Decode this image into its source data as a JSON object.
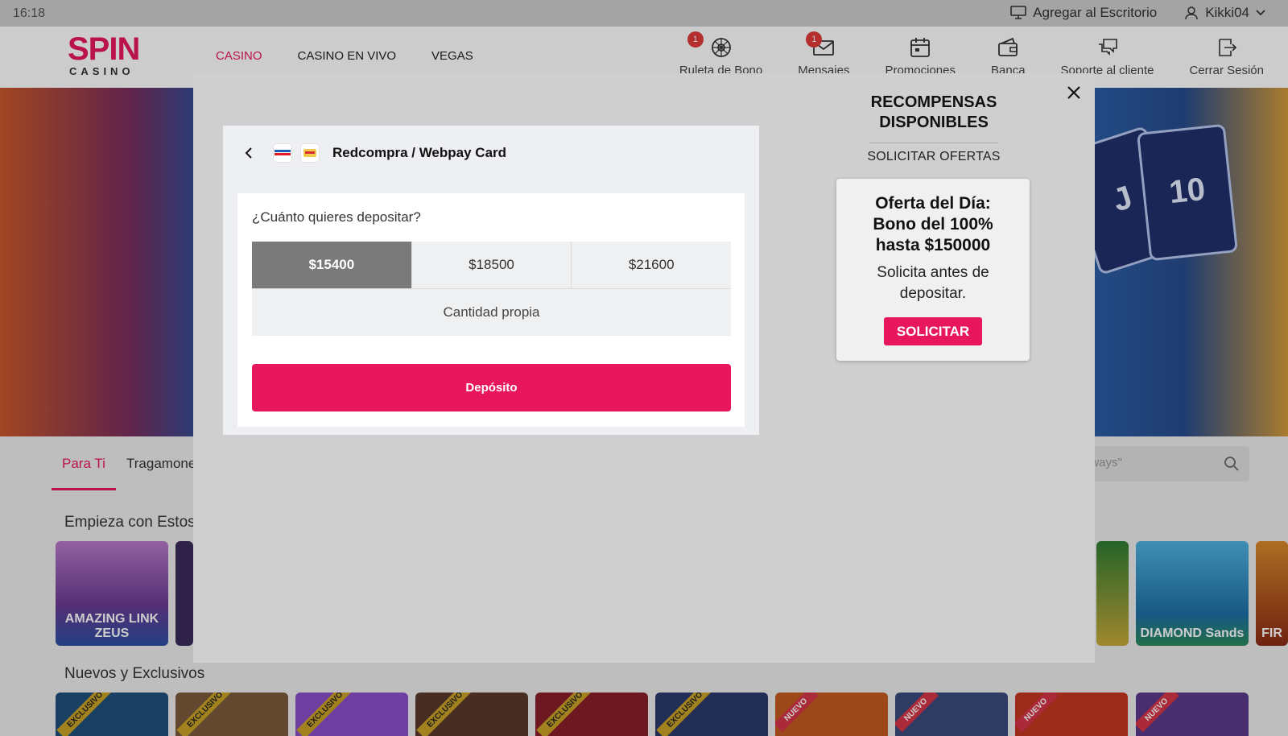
{
  "statusbar": {
    "time": "16:18",
    "add_desktop": "Agregar al Escritorio",
    "username": "Kikki04"
  },
  "brand": {
    "logo_top": "SPIN",
    "logo_bottom": "CASINO",
    "accent": "#e8175d"
  },
  "main_menu": [
    "CASINO",
    "CASINO EN VIVO",
    "VEGAS"
  ],
  "icon_nav": [
    {
      "label": "Ruleta de Bono",
      "badge": "1",
      "icon": "roulette-icon"
    },
    {
      "label": "Mensajes",
      "badge": "1",
      "icon": "mail-icon"
    },
    {
      "label": "Promociones",
      "icon": "calendar-icon"
    },
    {
      "label": "Banca",
      "icon": "wallet-icon"
    },
    {
      "label": "Soporte al cliente",
      "icon": "chat-icon"
    },
    {
      "label": "Cerrar Sesión",
      "icon": "logout-icon"
    }
  ],
  "lobby": {
    "tabs": [
      "Para Ti",
      "Tragamone"
    ],
    "search_placeholder": "aways\"",
    "section_1": "Empieza con Estos",
    "section_2": "Nuevos y Exclusivos",
    "tiles_row1": [
      "AMAZING LINK ZEUS",
      "DIAMOND Sands",
      "FIR"
    ],
    "ribbon_exclusive": "EXCLUSIVO",
    "ribbon_new": "NUEVO"
  },
  "deposit": {
    "title": "Redcompra / Webpay Card",
    "question": "¿Cuánto quieres depositar?",
    "amounts": [
      "$15400",
      "$18500",
      "$21600"
    ],
    "selected_amount": "$15400",
    "custom_amount": "Cantidad propia",
    "submit": "Depósito"
  },
  "rewards": {
    "heading": "RECOMPENSAS DISPONIBLES",
    "request_offers": "SOLICITAR OFERTAS",
    "offer": {
      "title": "Oferta del Día: Bono del 100% hasta $150000",
      "description": "Solicita antes de depositar.",
      "button": "SOLICITAR"
    }
  }
}
